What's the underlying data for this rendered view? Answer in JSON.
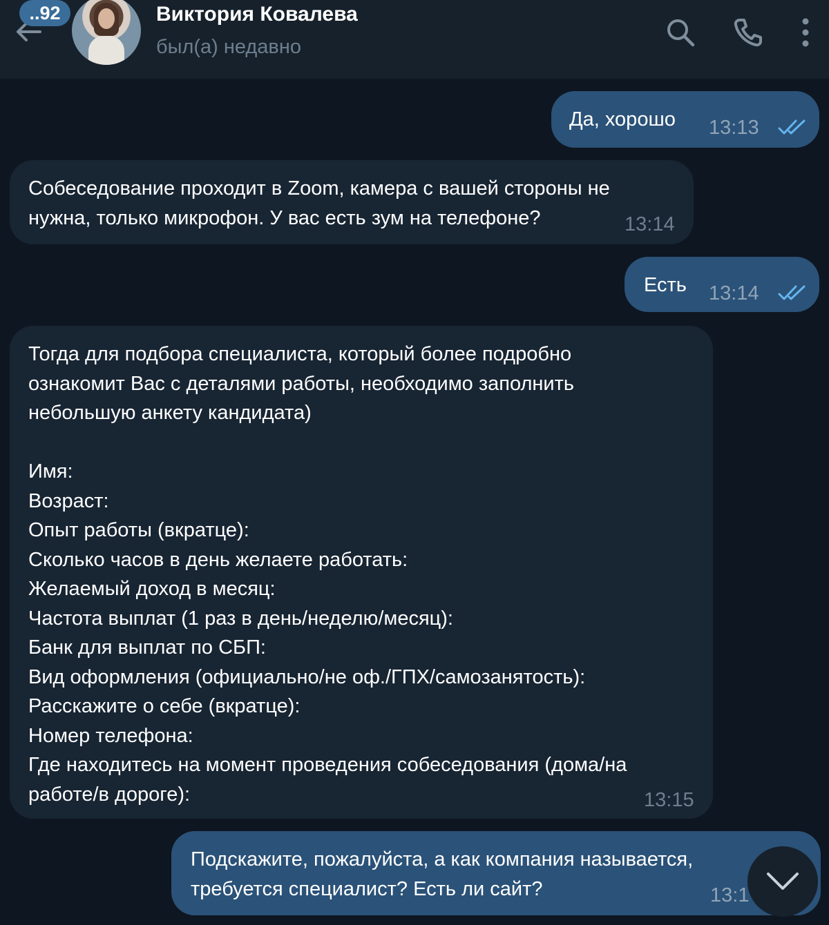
{
  "header": {
    "unread_badge": "..92",
    "contact_name": "Виктория Ковалева",
    "status": "был(а) недавно",
    "icons": [
      "back-arrow-icon",
      "search-icon",
      "phone-icon",
      "more-vertical-icon"
    ]
  },
  "messages": [
    {
      "direction": "out",
      "text": "Да, хорошо",
      "time": "13:13",
      "read": true
    },
    {
      "direction": "in",
      "text": "Собеседование проходит в Zoom, камера с вашей стороны не\nнужна, только микрофон. У вас есть зум на телефоне?",
      "time": "13:14"
    },
    {
      "direction": "out",
      "text": "Есть",
      "time": "13:14",
      "read": true
    },
    {
      "direction": "in",
      "text": "Тогда для подбора специалиста, который более подробно\nознакомит Вас с деталями работы, необходимо заполнить\nнебольшую анкету кандидата)\n\nИмя:\nВозраст:\nОпыт работы (вкратце):\nСколько часов в день желаете работать:\nЖелаемый доход в месяц:\nЧастота выплат (1 раз в день/неделю/месяц):\nБанк для выплат по СБП:\nВид оформления (официально/не оф./ГПХ/самозанятость):\nРасскажите о себе (вкратце):\nНомер телефона:\nГде находитесь на момент проведения собеседования (дома/на\nработе/в дороге):",
      "time": "13:15"
    },
    {
      "direction": "out",
      "text": "Подскажите, пожалуйста, а как компания называется, \nтребуется специалист? Есть ли сайт?",
      "time": "13:1"
    }
  ],
  "scroll_button": {
    "icon": "chevron-down-icon"
  },
  "colors": {
    "background": "#0e1621",
    "header": "#17212b",
    "outgoing_bubble": "#2b5278",
    "incoming_bubble": "#182533",
    "badge": "#3a6d99",
    "ticks": "#64b5ef"
  }
}
